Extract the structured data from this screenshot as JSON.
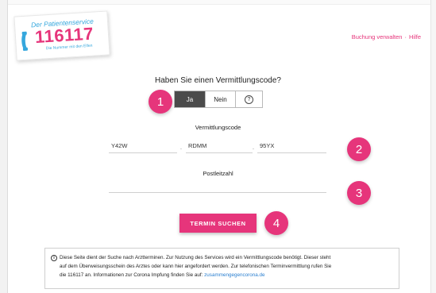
{
  "logo": {
    "tagline_top": "Der Patientenservice",
    "number": "116117",
    "tagline_bottom": "Die Nummer mit den Elfen",
    "accent_pink": "#e6357b",
    "accent_blue": "#35a7dd"
  },
  "nav": {
    "manage_booking": "Buchung verwalten",
    "help": "Hilfe"
  },
  "form": {
    "question": "Haben Sie einen Vermittlungscode?",
    "toggle": {
      "yes": "Ja",
      "no": "Nein",
      "help_glyph": "?",
      "selected": "Ja"
    },
    "code_label": "Vermittlungscode",
    "code_parts": [
      "Y42W",
      "RDMM",
      "95YX"
    ],
    "code_separator": ".",
    "postcode_label": "Postleitzahl",
    "postcode_value": "",
    "submit": "TERMIN SUCHEN"
  },
  "badges": [
    "1",
    "2",
    "3",
    "4"
  ],
  "info": {
    "icon_glyph": "i",
    "line1": "Diese Seite dient der Suche nach Arztterminen. Zur Nutzung des Services wird ein Vermittlungscode benötigt. Dieser steht",
    "line2": "auf dem Überweisungsschein des Arztes oder kann hier angefordert werden. Zur telefonischen Terminvermittlung rufen Sie",
    "line3_prefix": "die 116117 an. Informationen zur Corona Impfung finden Sie auf: ",
    "link": "zusammengegencorona.de"
  }
}
